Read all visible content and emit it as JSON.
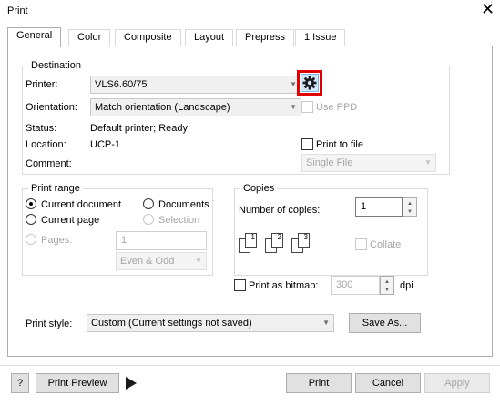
{
  "window": {
    "title": "Print",
    "close": "✕"
  },
  "tabs": [
    "General",
    "Color",
    "Composite",
    "Layout",
    "Prepress",
    "1 Issue"
  ],
  "destination": {
    "group_label": "Destination",
    "printer_label": "Printer:",
    "printer_value": "VLS6.60/75",
    "orientation_label": "Orientation:",
    "orientation_value": "Match orientation (Landscape)",
    "use_ppd": "Use PPD",
    "status_label": "Status:",
    "status_value": "Default printer; Ready",
    "location_label": "Location:",
    "location_value": "UCP-1",
    "print_to_file": "Print to file",
    "comment_label": "Comment:",
    "file_mode": "Single File"
  },
  "print_range": {
    "group_label": "Print range",
    "current_document": "Current document",
    "documents": "Documents",
    "current_page": "Current page",
    "selection": "Selection",
    "pages_label": "Pages:",
    "pages_value": "1",
    "even_odd": "Even & Odd"
  },
  "copies": {
    "group_label": "Copies",
    "number_label": "Number of copies:",
    "number_value": "1",
    "collate": "Collate",
    "page_numbers": [
      "1",
      "1",
      "2",
      "2",
      "3",
      "3"
    ]
  },
  "bitmap": {
    "label": "Print as bitmap:",
    "value": "300",
    "unit": "dpi"
  },
  "style": {
    "label": "Print style:",
    "value": "Custom (Current settings not saved)",
    "save_as": "Save As..."
  },
  "footer": {
    "help": "?",
    "preview": "Print Preview",
    "print": "Print",
    "cancel": "Cancel",
    "apply": "Apply"
  },
  "colors": {
    "highlight": "#e00000",
    "gear_bg": "#cfe6fb"
  }
}
